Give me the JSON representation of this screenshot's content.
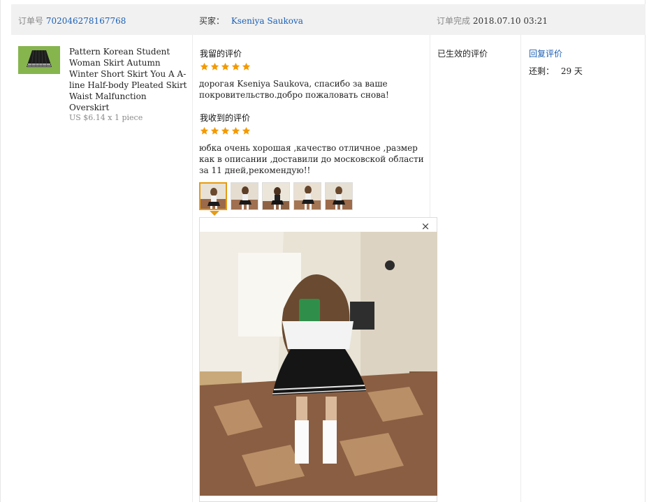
{
  "header": {
    "order_label": "订单号",
    "order_number": "702046278167768",
    "buyer_label": "买家：",
    "buyer_name": "Kseniya Saukova",
    "completed_label": "订单完成",
    "completed_time": "2018.07.10 03:21"
  },
  "product": {
    "title": "Pattern Korean Student Woman Skirt Autumn Winter Short Skirt You A A-line Half-body Pleated Skirt Waist Malfunction Overskirt",
    "price": "US $6.14 x 1 piece",
    "thumbnail_icon": "skirt-thumbnail"
  },
  "left_feedback": {
    "title": "我留的评价",
    "rating": 5,
    "text": "дорогая Kseniya Saukova, спасибо за ваше покровительство.добро пожаловать снова!"
  },
  "received_feedback": {
    "title": "我收到的评价",
    "rating": 5,
    "text": "юбка очень хорошая ,качество отличное ,размер как в описании ,доставили до московской области за 11 дней,рекомендую!!"
  },
  "photos": {
    "count": 5,
    "active_index": 0,
    "close_symbol": "×"
  },
  "status": {
    "label": "已生效的评价"
  },
  "actions": {
    "reply_label": "回复评价",
    "remaining_label": "还剩：",
    "remaining_value": "29 天"
  },
  "colors": {
    "link": "#1a5fb4",
    "star": "#f29a00",
    "active_border": "#e49b16",
    "header_bg": "#f1f1f1"
  }
}
